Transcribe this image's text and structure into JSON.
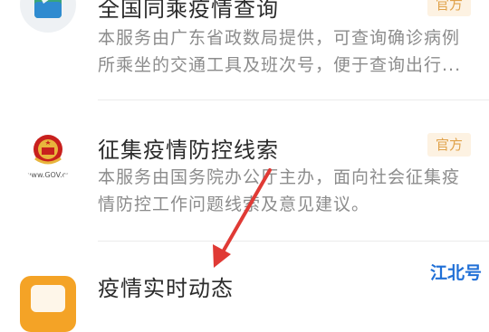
{
  "items": [
    {
      "title": "全国同乘疫情查询",
      "badge": "官方",
      "desc_line1": "本服务由广东省政数局提供，可查询确诊病例",
      "desc_line2": "所乘坐的交通工具及班次号，便于查询出行..."
    },
    {
      "title": "征集疫情防控线索",
      "badge": "官方",
      "icon_caption": "www.GOV.cn",
      "desc_line1": "本服务由国务院办公厅主办，面向社会征集疫",
      "desc_line2": "情防控工作问题线索及意见建议。"
    },
    {
      "title": "疫情实时动态"
    }
  ],
  "watermark": "江北号",
  "colors": {
    "badge_text": "#e0a24a",
    "badge_bg": "#fdf2e2",
    "arrow": "#e03a35",
    "watermark": "#1f6fd6"
  }
}
